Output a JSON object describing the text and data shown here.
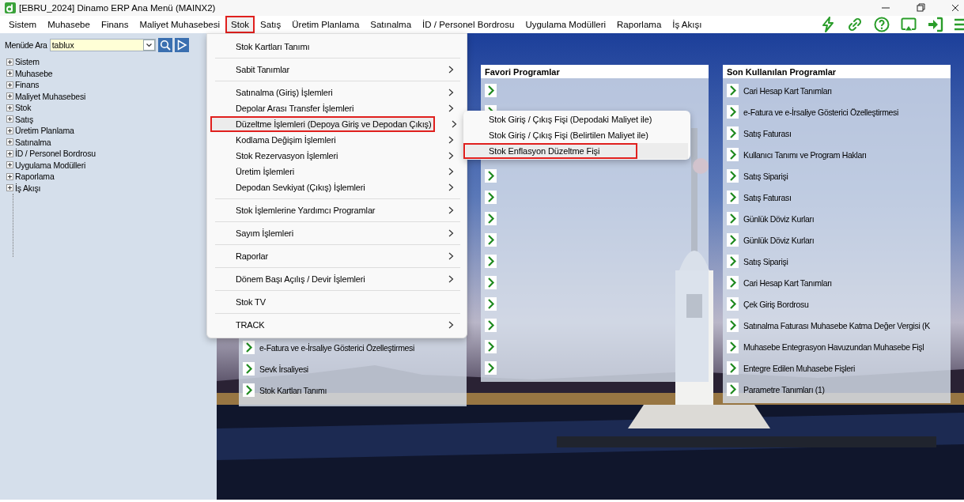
{
  "window": {
    "title": "[EBRU_2024] Dinamo ERP Ana Menü (MAINX2)"
  },
  "menu_bar": [
    {
      "label": "Sistem",
      "selected": false
    },
    {
      "label": "Muhasebe",
      "selected": false
    },
    {
      "label": "Finans",
      "selected": false
    },
    {
      "label": "Maliyet Muhasebesi",
      "selected": false
    },
    {
      "label": "Stok",
      "selected": true,
      "highlighted": true
    },
    {
      "label": "Satış",
      "selected": false
    },
    {
      "label": "Üretim Planlama",
      "selected": false
    },
    {
      "label": "Satınalma",
      "selected": false
    },
    {
      "label": "İD / Personel Bordrosu",
      "selected": false
    },
    {
      "label": "Uygulama Modülleri",
      "selected": false
    },
    {
      "label": "Raporlama",
      "selected": false
    },
    {
      "label": "İş Akışı",
      "selected": false
    }
  ],
  "toolbar_icons": [
    {
      "kind": "lightning"
    },
    {
      "kind": "link"
    },
    {
      "kind": "help"
    },
    {
      "kind": "cast"
    },
    {
      "kind": "sign-in"
    },
    {
      "kind": "menu"
    }
  ],
  "sidebar": {
    "search_label": "Menüde Ara",
    "search_value": "tablux",
    "tree": [
      {
        "label": "Sistem",
        "expanded": false
      },
      {
        "label": "Muhasebe",
        "expanded": false
      },
      {
        "label": "Finans",
        "expanded": false
      },
      {
        "label": "Maliyet Muhasebesi",
        "expanded": false
      },
      {
        "label": "Stok",
        "expanded": false
      },
      {
        "label": "Satış",
        "expanded": false
      },
      {
        "label": "Üretim Planlama",
        "expanded": false
      },
      {
        "label": "Satınalma",
        "expanded": false
      },
      {
        "label": "İD / Personel Bordrosu",
        "expanded": false
      },
      {
        "label": "Uygulama Modülleri",
        "expanded": false
      },
      {
        "label": "Raporlama",
        "expanded": false
      },
      {
        "label": "İş Akışı",
        "expanded": false
      }
    ]
  },
  "lower_panel": {
    "items": [
      "e-Fatura ve e-İrsaliye Gösterici Özelleştirmesi",
      "Sevk İrsaliyesi",
      "Stok Kartları Tanımı"
    ]
  },
  "favorites": {
    "title": "Favori Programlar"
  },
  "recent": {
    "title": "Son Kullanılan Programlar",
    "items": [
      "Cari Hesap Kart Tanımları",
      "e-Fatura ve e-İrsaliye Gösterici Özelleştirmesi",
      "Satış Faturası",
      "Kullanıcı Tanımı ve Program Hakları",
      "Satış Siparişi",
      "Satış Faturası",
      "Günlük Döviz Kurları",
      "Günlük Döviz Kurları",
      "Satış Siparişi",
      "Cari Hesap Kart Tanımları",
      "Çek Giriş Bordrosu",
      "Satınalma Faturası Muhasebe Katma Değer Vergisi (K",
      "Muhasebe Entegrasyon Havuzundan Muhasebe Fişl",
      "Entegre Edilen Muhasebe Fişleri",
      "Parametre Tanımları (1)"
    ]
  },
  "stok_menu": {
    "groups": [
      [
        {
          "label": "Stok Kartları Tanımı",
          "submenu": false,
          "selected": false
        }
      ],
      [
        {
          "label": "Sabit Tanımlar",
          "submenu": true,
          "selected": false
        }
      ],
      [
        {
          "label": "Satınalma (Giriş) İşlemleri",
          "submenu": true,
          "selected": false
        },
        {
          "label": "Depolar Arası Transfer İşlemleri",
          "submenu": true,
          "selected": false
        },
        {
          "label": "Düzeltme İşlemleri (Depoya Giriş ve Depodan Çıkış)",
          "submenu": true,
          "selected": true,
          "highlighted": true
        },
        {
          "label": "Kodlama Değişim İşlemleri",
          "submenu": true,
          "selected": false
        },
        {
          "label": "Stok Rezervasyon İşlemleri",
          "submenu": true,
          "selected": false
        },
        {
          "label": "Üretim İşlemleri",
          "submenu": true,
          "selected": false
        },
        {
          "label": "Depodan Sevkiyat (Çıkış) İşlemleri",
          "submenu": true,
          "selected": false
        }
      ],
      [
        {
          "label": "Stok İşlemlerine Yardımcı Programlar",
          "submenu": true,
          "selected": false
        }
      ],
      [
        {
          "label": "Sayım İşlemleri",
          "submenu": true,
          "selected": false
        }
      ],
      [
        {
          "label": "Raporlar",
          "submenu": true,
          "selected": false
        }
      ],
      [
        {
          "label": "Dönem Başı Açılış / Devir İşlemleri",
          "submenu": true,
          "selected": false
        }
      ],
      [
        {
          "label": "Stok TV",
          "submenu": false,
          "selected": false
        }
      ],
      [
        {
          "label": "TRACK",
          "submenu": true,
          "selected": false
        }
      ]
    ]
  },
  "submenu": {
    "items": [
      {
        "label": "Stok Giriş / Çıkış Fişi (Depodaki Maliyet ile)",
        "selected": false
      },
      {
        "label": "Stok Giriş / Çıkış Fişi (Belirtilen Maliyet ile)",
        "selected": false
      },
      {
        "label": "Stok Enflasyon Düzeltme Fişi",
        "selected": true,
        "highlighted": true
      }
    ]
  }
}
